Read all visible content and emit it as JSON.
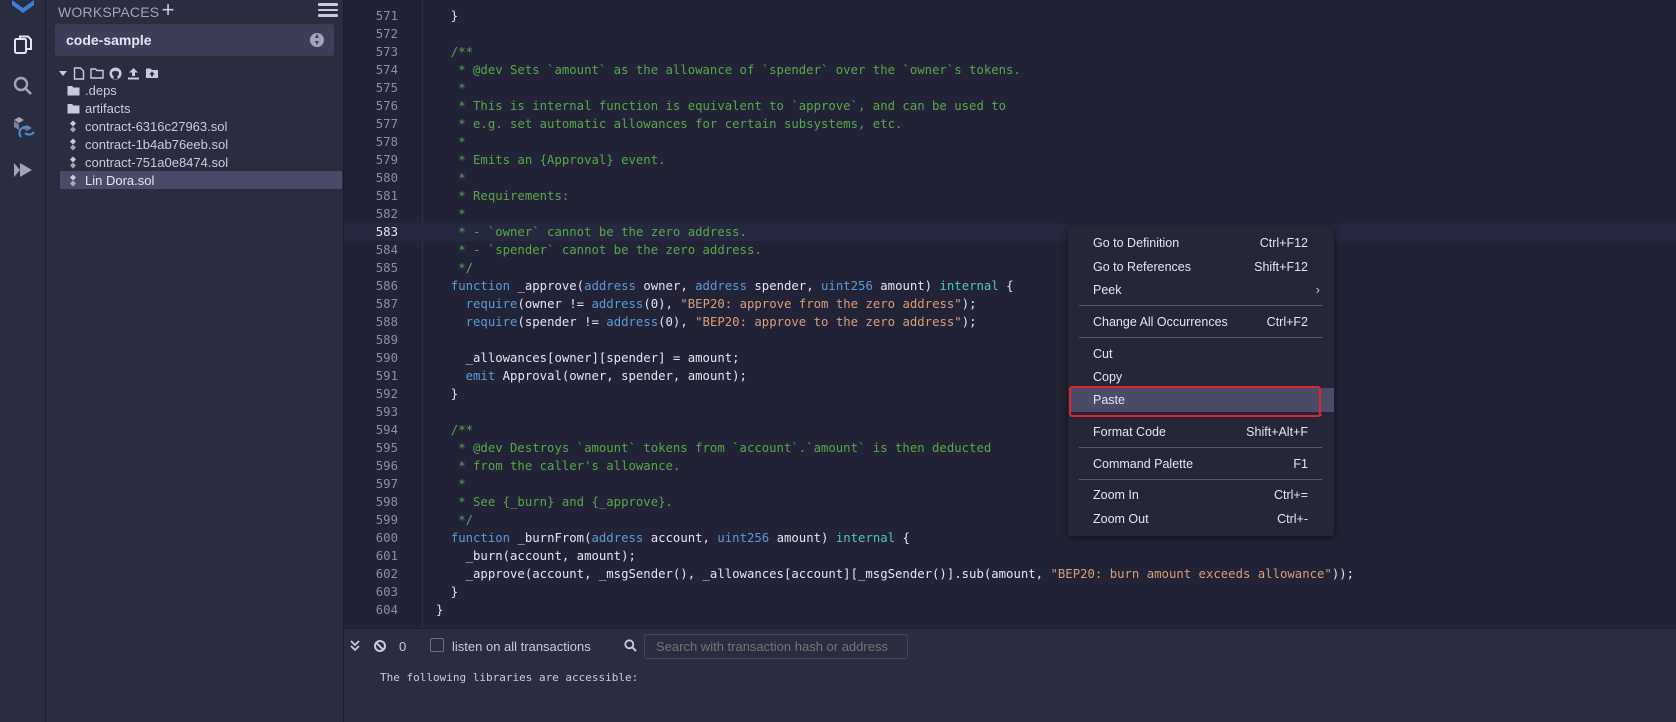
{
  "sidebar": {
    "icons": [
      "file-explorer-icon",
      "search-icon",
      "solidity-compiler-icon",
      "deploy-run-icon"
    ]
  },
  "explorer": {
    "title": "WORKSPACES",
    "workspace": "code-sample",
    "items": [
      {
        "label": ".deps",
        "type": "folder"
      },
      {
        "label": "artifacts",
        "type": "folder"
      },
      {
        "label": "contract-6316c27963.sol",
        "type": "solidity"
      },
      {
        "label": "contract-1b4ab76eeb.sol",
        "type": "solidity"
      },
      {
        "label": "contract-751a0e8474.sol",
        "type": "solidity"
      },
      {
        "label": "Lin Dora.sol",
        "type": "solidity",
        "selected": true
      }
    ]
  },
  "editor": {
    "current_line": 583,
    "lines": [
      {
        "n": "571",
        "t": "  }"
      },
      {
        "n": "572",
        "t": ""
      },
      {
        "n": "573",
        "t": "  /**"
      },
      {
        "n": "574",
        "t": "   * @dev Sets `amount` as the allowance of `spender` over the `owner`s tokens."
      },
      {
        "n": "575",
        "t": "   *"
      },
      {
        "n": "576",
        "t": "   * This is internal function is equivalent to `approve`, and can be used to"
      },
      {
        "n": "577",
        "t": "   * e.g. set automatic allowances for certain subsystems, etc."
      },
      {
        "n": "578",
        "t": "   *"
      },
      {
        "n": "579",
        "t": "   * Emits an {Approval} event."
      },
      {
        "n": "580",
        "t": "   *"
      },
      {
        "n": "581",
        "t": "   * Requirements:"
      },
      {
        "n": "582",
        "t": "   *"
      },
      {
        "n": "583",
        "t": "   * - `owner` cannot be the zero address."
      },
      {
        "n": "584",
        "t": "   * - `spender` cannot be the zero address."
      },
      {
        "n": "585",
        "t": "   */"
      },
      {
        "n": "586",
        "t": "  function _approve(address owner, address spender, uint256 amount) internal {"
      },
      {
        "n": "587",
        "t": "    require(owner != address(0), \"BEP20: approve from the zero address\");"
      },
      {
        "n": "588",
        "t": "    require(spender != address(0), \"BEP20: approve to the zero address\");"
      },
      {
        "n": "589",
        "t": ""
      },
      {
        "n": "590",
        "t": "    _allowances[owner][spender] = amount;"
      },
      {
        "n": "591",
        "t": "    emit Approval(owner, spender, amount);"
      },
      {
        "n": "592",
        "t": "  }"
      },
      {
        "n": "593",
        "t": ""
      },
      {
        "n": "594",
        "t": "  /**"
      },
      {
        "n": "595",
        "t": "   * @dev Destroys `amount` tokens from `account`.`amount` is then deducted"
      },
      {
        "n": "596",
        "t": "   * from the caller's allowance."
      },
      {
        "n": "597",
        "t": "   *"
      },
      {
        "n": "598",
        "t": "   * See {_burn} and {_approve}."
      },
      {
        "n": "599",
        "t": "   */"
      },
      {
        "n": "600",
        "t": "  function _burnFrom(address account, uint256 amount) internal {"
      },
      {
        "n": "601",
        "t": "    _burn(account, amount);"
      },
      {
        "n": "602",
        "t": "    _approve(account, _msgSender(), _allowances[account][_msgSender()].sub(amount, \"BEP20: burn amount exceeds allowance\"));"
      },
      {
        "n": "603",
        "t": "  }"
      },
      {
        "n": "604",
        "t": "}"
      }
    ]
  },
  "terminal": {
    "count": "0",
    "listen_label": "listen on all transactions",
    "search_placeholder": "Search with transaction hash or address",
    "output": "The following libraries are accessible:"
  },
  "context_menu": {
    "items": [
      {
        "label": "Go to Definition",
        "key": "Ctrl+F12"
      },
      {
        "label": "Go to References",
        "key": "Shift+F12"
      },
      {
        "label": "Peek",
        "key": "",
        "submenu": true
      },
      {
        "label": "Change All Occurrences",
        "key": "Ctrl+F2"
      },
      {
        "label": "Cut",
        "key": ""
      },
      {
        "label": "Copy",
        "key": ""
      },
      {
        "label": "Paste",
        "key": "",
        "hover": true
      },
      {
        "label": "Format Code",
        "key": "Shift+Alt+F"
      },
      {
        "label": "Command Palette",
        "key": "F1"
      },
      {
        "label": "Zoom In",
        "key": "Ctrl+="
      },
      {
        "label": "Zoom Out",
        "key": "Ctrl+-"
      }
    ]
  },
  "colors": {
    "background": "#222336",
    "panel": "#2a2c3f",
    "comment": "#55a84a",
    "keyword": "#569cd6",
    "string": "#d79e7a",
    "highlight_box": "#e0262a"
  }
}
